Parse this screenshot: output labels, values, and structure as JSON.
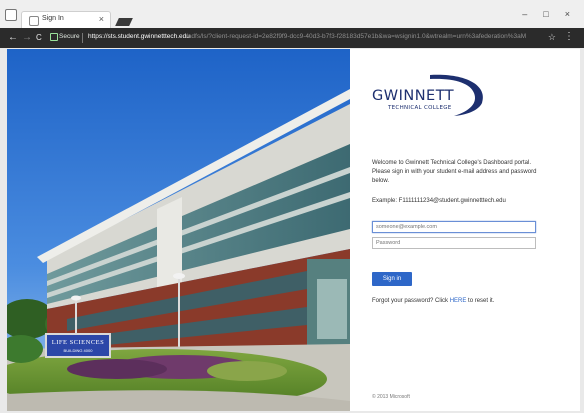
{
  "browser": {
    "tab_title": "Sign In",
    "tab_close": "×",
    "window_controls": [
      "–",
      "□",
      "×"
    ],
    "nav": {
      "back": "←",
      "forward": "→",
      "reload": "C"
    },
    "secure_label": "Secure",
    "url_host": "https://sts.student.gwinnetttech.edu",
    "url_path": "/adfs/ls/?client-request-id=2e82f9f9-dcc9-40d3-b7f3-f28183d57e1b&wa=wsignin1.0&wtrealm=urn%3afederation%3aMicrosoftOnline",
    "star": "☆",
    "menu": "⋮"
  },
  "hero": {
    "sign_line1": "Life Sciences",
    "sign_line2": "Building 4000"
  },
  "login": {
    "logo_name": "GWINNETT",
    "logo_sub": "TECHNICAL COLLEGE",
    "welcome": "Welcome to Gwinnett Technical College's Dashboard portal. Please sign in with your student e-mail address and password below.",
    "example": "Example: F1111111234@student.gwinnetttech.edu",
    "email_placeholder": "someone@example.com",
    "password_placeholder": "Password",
    "signin_label": "Sign in",
    "forgot_prefix": "Forgot your password? Click ",
    "forgot_link": "HERE",
    "forgot_suffix": " to reset it.",
    "copyright": "© 2013 Microsoft"
  },
  "colors": {
    "accent": "#2e67c8",
    "logo": "#1d2f6f",
    "chrome_dark": "#2b2b2b"
  }
}
